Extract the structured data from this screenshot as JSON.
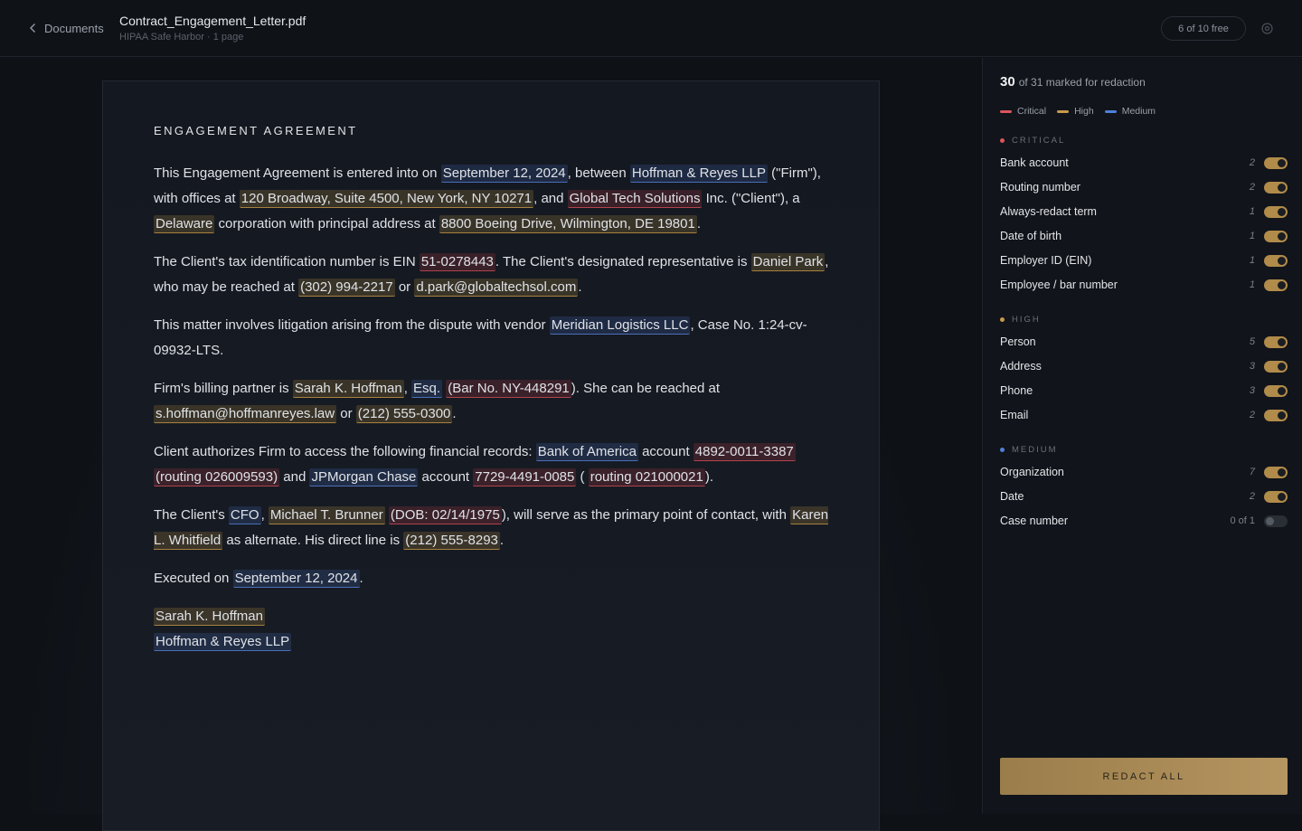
{
  "header": {
    "back_label": "Documents",
    "file_name": "Contract_Engagement_Letter.pdf",
    "file_meta": "HIPAA Safe Harbor · 1 page",
    "quota": "6 of 10 free"
  },
  "document": {
    "heading": "ENGAGEMENT AGREEMENT",
    "paragraphs": [
      [
        {
          "t": "This Engagement Agreement is entered into on "
        },
        {
          "t": "September 12, 2024",
          "c": "med"
        },
        {
          "t": ", between "
        },
        {
          "t": "Hoffman & Reyes LLP",
          "c": "med"
        },
        {
          "t": " (\"Firm\"), with offices at "
        },
        {
          "t": "120 Broadway, Suite 4500, New York, NY 10271",
          "c": "high"
        },
        {
          "t": ", and "
        },
        {
          "t": "Global Tech Solutions",
          "c": "crit"
        },
        {
          "t": " Inc. (\"Client\"), a "
        },
        {
          "t": "Delaware",
          "c": "high"
        },
        {
          "t": " corporation with principal address at "
        },
        {
          "t": "8800 Boeing Drive, Wilmington, DE 19801",
          "c": "high"
        },
        {
          "t": "."
        }
      ],
      [
        {
          "t": "The Client's tax identification number is EIN "
        },
        {
          "t": "51-0278443",
          "c": "crit"
        },
        {
          "t": ". The Client's designated representative is "
        },
        {
          "t": "Daniel Park",
          "c": "high"
        },
        {
          "t": ", who may be reached at "
        },
        {
          "t": "(302) 994-2217",
          "c": "high"
        },
        {
          "t": " or "
        },
        {
          "t": "d.park@globaltechsol.com",
          "c": "high"
        },
        {
          "t": "."
        }
      ],
      [
        {
          "t": "This matter involves litigation arising from the dispute with vendor "
        },
        {
          "t": "Meridian Logistics LLC",
          "c": "med"
        },
        {
          "t": ", Case No. 1:24-cv-09932-LTS."
        }
      ],
      [
        {
          "t": "Firm's billing partner is "
        },
        {
          "t": "Sarah K. Hoffman",
          "c": "high"
        },
        {
          "t": ", "
        },
        {
          "t": "Esq.",
          "c": "med"
        },
        {
          "t": " "
        },
        {
          "t": "(Bar No. NY-448291",
          "c": "crit"
        },
        {
          "t": "). She can be reached at "
        },
        {
          "t": "s.hoffman@hoffmanreyes.law",
          "c": "high"
        },
        {
          "t": " or "
        },
        {
          "t": "(212) 555-0300",
          "c": "high"
        },
        {
          "t": "."
        }
      ],
      [
        {
          "t": "Client authorizes Firm to access the following financial records: "
        },
        {
          "t": "Bank of America",
          "c": "med"
        },
        {
          "t": " account "
        },
        {
          "t": "4892-0011-3387",
          "c": "crit"
        },
        {
          "t": " "
        },
        {
          "t": "(routing 026009593)",
          "c": "crit"
        },
        {
          "t": " and "
        },
        {
          "t": "JPMorgan Chase",
          "c": "med"
        },
        {
          "t": " account "
        },
        {
          "t": "7729-4491-0085",
          "c": "crit"
        },
        {
          "t": " ( "
        },
        {
          "t": "routing 021000021",
          "c": "crit"
        },
        {
          "t": ")."
        }
      ],
      [
        {
          "t": "The Client's "
        },
        {
          "t": "CFO",
          "c": "med"
        },
        {
          "t": ", "
        },
        {
          "t": "Michael T. Brunner",
          "c": "high"
        },
        {
          "t": " "
        },
        {
          "t": "(DOB: 02/14/1975",
          "c": "crit"
        },
        {
          "t": "), will serve as the primary point of contact, with "
        },
        {
          "t": "Karen L. Whitfield",
          "c": "high"
        },
        {
          "t": " as alternate. His direct line is "
        },
        {
          "t": "(212) 555-8293",
          "c": "high"
        },
        {
          "t": "."
        }
      ],
      [
        {
          "t": "Executed on "
        },
        {
          "t": "September 12, 2024",
          "c": "med"
        },
        {
          "t": "."
        }
      ]
    ],
    "signature": [
      {
        "t": "Sarah K. Hoffman",
        "c": "high"
      },
      {
        "t": "Hoffman & Reyes LLP",
        "c": "med"
      }
    ]
  },
  "sidebar": {
    "count_number": "30",
    "count_text": "of 31 marked for redaction",
    "legend": [
      {
        "label": "Critical",
        "color": "#d9555e"
      },
      {
        "label": "High",
        "color": "#c99a4a"
      },
      {
        "label": "Medium",
        "color": "#4f7fd9"
      }
    ],
    "groups": [
      {
        "title": "CRITICAL",
        "color": "#d9555e",
        "items": [
          {
            "label": "Bank account",
            "count": "2",
            "on": true
          },
          {
            "label": "Routing number",
            "count": "2",
            "on": true
          },
          {
            "label": "Always-redact term",
            "count": "1",
            "on": true
          },
          {
            "label": "Date of birth",
            "count": "1",
            "on": true
          },
          {
            "label": "Employer ID (EIN)",
            "count": "1",
            "on": true
          },
          {
            "label": "Employee / bar number",
            "count": "1",
            "on": true
          }
        ]
      },
      {
        "title": "HIGH",
        "color": "#c99a4a",
        "items": [
          {
            "label": "Person",
            "count": "5",
            "on": true
          },
          {
            "label": "Address",
            "count": "3",
            "on": true
          },
          {
            "label": "Phone",
            "count": "3",
            "on": true
          },
          {
            "label": "Email",
            "count": "2",
            "on": true
          }
        ]
      },
      {
        "title": "MEDIUM",
        "color": "#4f7fd9",
        "items": [
          {
            "label": "Organization",
            "count": "7",
            "on": true
          },
          {
            "label": "Date",
            "count": "2",
            "on": true
          },
          {
            "label": "Case number",
            "count": "0 of 1",
            "on": false
          }
        ]
      }
    ],
    "redact_button": "REDACT ALL"
  }
}
